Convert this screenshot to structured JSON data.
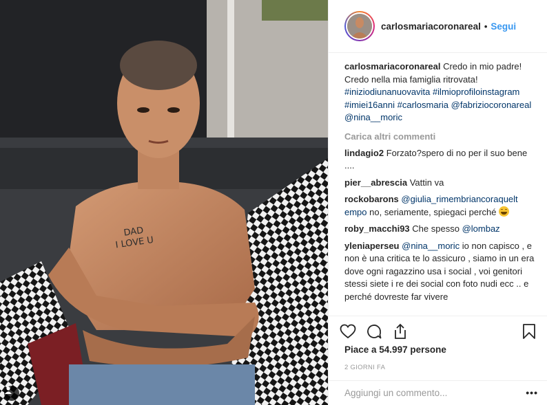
{
  "post": {
    "username": "carlosmariacoronareal",
    "follow_label": "Segui",
    "separator": "•",
    "photo": {
      "chest_writing_line1": "DAD",
      "chest_writing_line2": "I LOVE U"
    },
    "caption": {
      "username": "carlosmariacoronareal",
      "text": "Credo in mio padre! Credo nella mia famiglia ritrovata!",
      "tags": [
        "#iniziodiunanuovavita",
        "#ilmioprofiloinstagram",
        "#imiei16anni",
        "#carlosmaria",
        "@fabriziocoronareal",
        "@nina__moric"
      ]
    },
    "load_more_label": "Carica altri commenti",
    "comments": [
      {
        "username": "lindagio2",
        "text": "Forzato?spero di no per il suo bene ...."
      },
      {
        "username": "pier__abrescia",
        "text": "Vattin va"
      },
      {
        "username": "rockobarons",
        "mention": "@giulia_rimembriancoraquelt empo",
        "text": "no, seriamente, spiegaci perché",
        "emoji": "grinning-face"
      },
      {
        "username": "roby_macchi93",
        "text": "Che spesso",
        "mention": "@lombaz"
      },
      {
        "username": "yleniaperseu",
        "mention": "@nina__moric",
        "text": "io non capisco , e non è una critica te lo assicuro , siamo in un era dove ogni ragazzino usa i social , voi genitori stessi siete i re dei social con foto nudi ecc .. e perché dovreste far vivere"
      }
    ],
    "likes_label": "Piace a 54.997 persone",
    "time_label": "2 GIORNI FA",
    "add_comment_placeholder": "Aggiungi un commento...",
    "more_label": "•••",
    "icons": [
      "heart-icon",
      "comment-icon",
      "share-icon",
      "bookmark-icon",
      "user-tag-icon"
    ],
    "colors": {
      "link": "#3897f0",
      "hashtag": "#003569",
      "muted": "#999999",
      "text": "#262626"
    }
  }
}
